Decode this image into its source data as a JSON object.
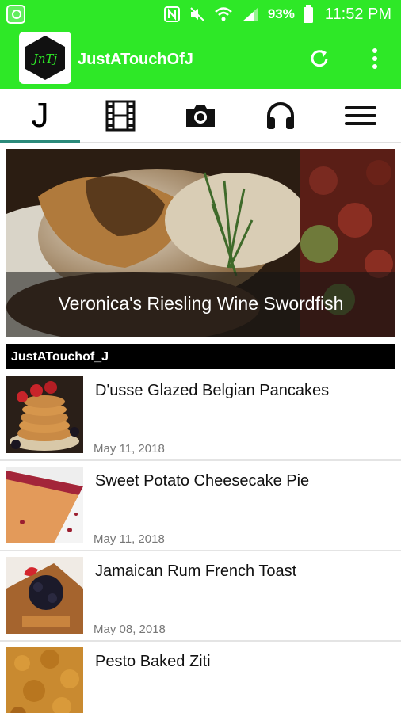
{
  "status_bar": {
    "battery_pct": "93%",
    "time": "11:52 PM"
  },
  "app_bar": {
    "logo_text": "JnTj",
    "title": "JustATouchOfJ"
  },
  "tabs": [
    {
      "label": "J",
      "icon": "j-letter",
      "active": true
    },
    {
      "icon": "film-icon"
    },
    {
      "icon": "camera-icon"
    },
    {
      "icon": "headphones-icon"
    },
    {
      "icon": "hamburger-menu-icon"
    }
  ],
  "hero": {
    "caption": "Veronica's Riesling Wine Swordfish"
  },
  "section": {
    "title": "JustATouchof_J"
  },
  "posts": [
    {
      "title": "D'usse Glazed Belgian Pancakes",
      "date": "May 11, 2018"
    },
    {
      "title": "Sweet Potato Cheesecake Pie",
      "date": "May 11, 2018"
    },
    {
      "title": "Jamaican Rum French Toast",
      "date": "May 08, 2018"
    },
    {
      "title": "Pesto Baked Ziti",
      "date": ""
    }
  ],
  "colors": {
    "brand_green": "#2ee827",
    "tab_indicator": "#2b8a7a"
  }
}
